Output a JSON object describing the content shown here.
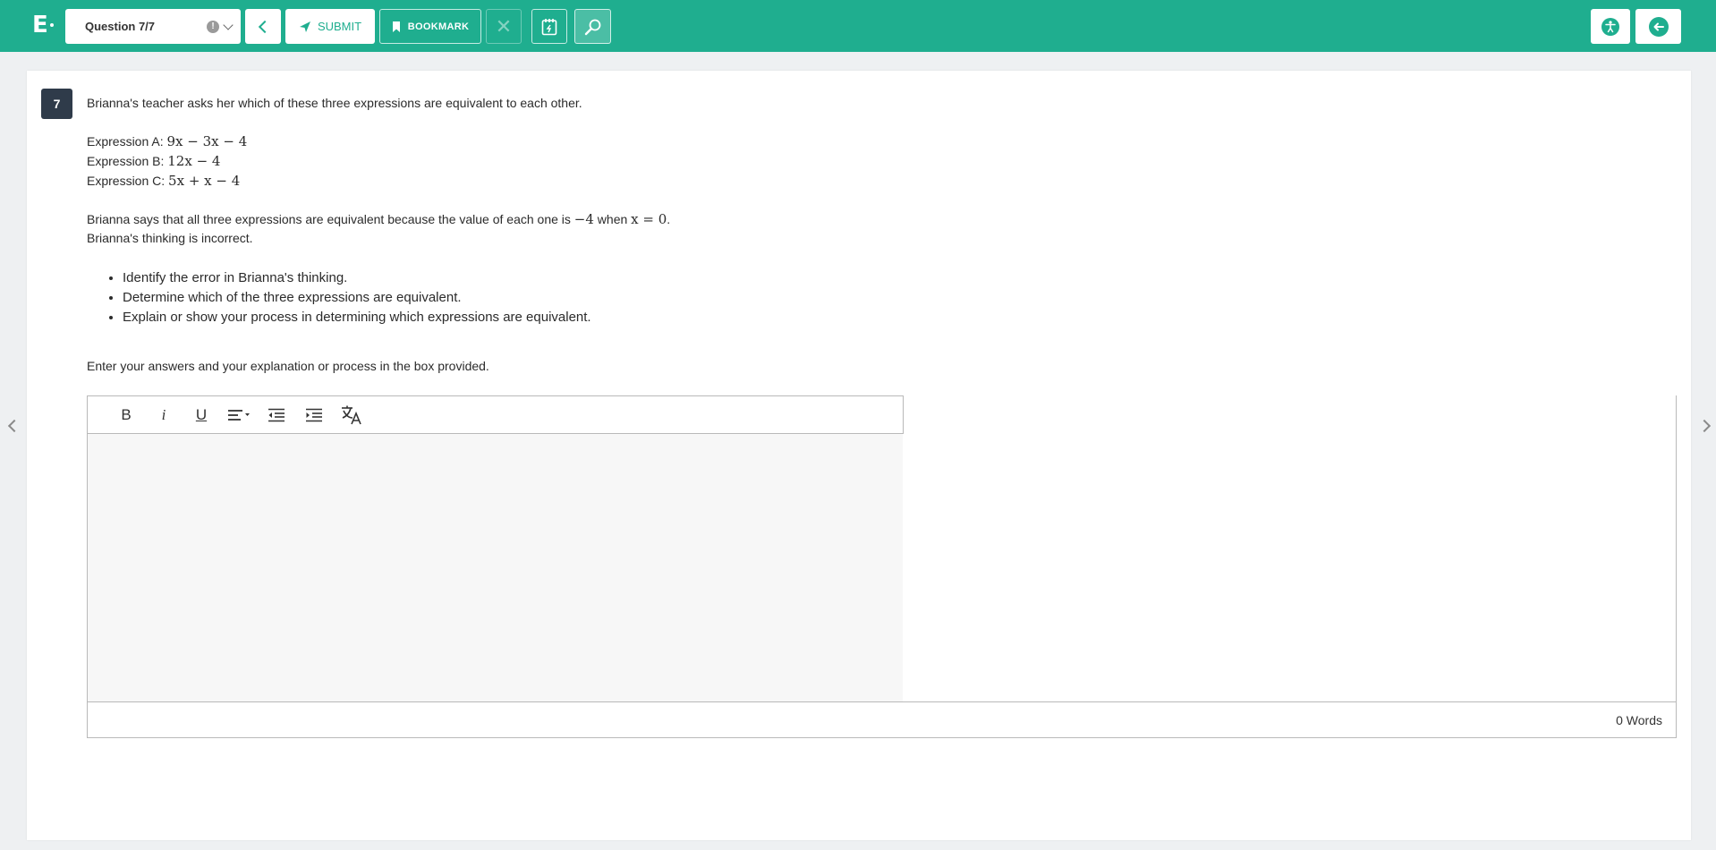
{
  "header": {
    "logo_letter": "E",
    "question_selector": "Question 7/7",
    "flag_glyph": "!",
    "submit_label": "SUBMIT",
    "bookmark_label": "BOOKMARK",
    "close_glyph": "✕"
  },
  "question": {
    "number": "7",
    "intro": "Brianna's teacher asks her which of these three expressions are equivalent to each other.",
    "expressions": [
      {
        "label": "Expression A: ",
        "math": "9x − 3x − 4"
      },
      {
        "label": "Expression B: ",
        "math": "12x − 4"
      },
      {
        "label": "Expression C:  ",
        "math": "5x + x − 4"
      }
    ],
    "claim_prefix": "Brianna says that all three expressions are equivalent because the value of each one is ",
    "claim_value": "−4",
    "claim_mid": " when ",
    "claim_condition": "x = 0",
    "claim_suffix": ".",
    "incorrect_statement": "Brianna's thinking is incorrect.",
    "tasks": [
      "Identify the error in Brianna's thinking.",
      "Determine which of the three expressions are equivalent.",
      "Explain or show your process in determining which expressions are equivalent."
    ],
    "instruction": "Enter your answers and your explanation or process in the box provided."
  },
  "editor": {
    "tools": [
      "bold-icon",
      "italic-icon",
      "underline-icon",
      "align-icon",
      "outdent-icon",
      "indent-icon",
      "translate-icon"
    ],
    "bold_glyph": "B",
    "italic_glyph": "i",
    "underline_glyph": "U",
    "word_count": "0 Words"
  },
  "colors": {
    "brand": "#1fae8f",
    "question_badge": "#2f3b4a"
  }
}
